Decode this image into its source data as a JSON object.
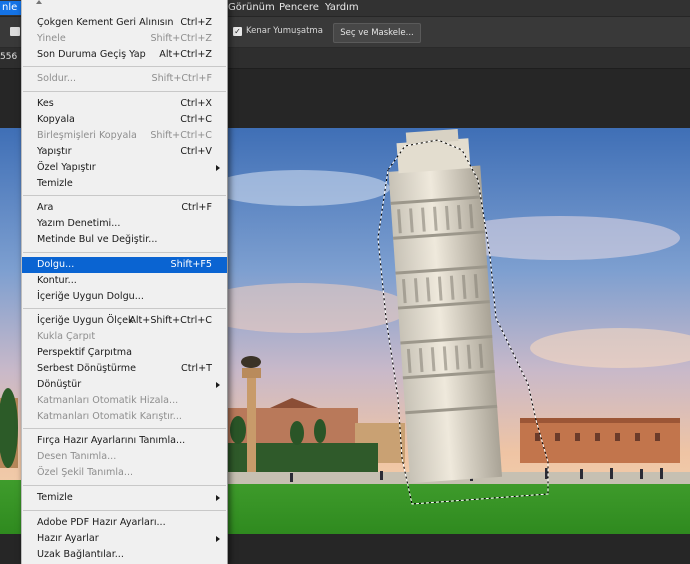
{
  "menubar": {
    "left_fragment": "nle",
    "items": [
      "Görünüm",
      "Pencere",
      "Yardım"
    ]
  },
  "options": {
    "antialias_label": "Kenar Yumuşatma",
    "antialias_checked": true,
    "select_mask_label": "Seç ve Maskele..."
  },
  "tab": {
    "fragment": "556"
  },
  "edit_menu": {
    "items": [
      {
        "label": "Çokgen Kement Geri Alınısın",
        "shortcut": "Ctrl+Z",
        "disabled": false
      },
      {
        "label": "Yinele",
        "shortcut": "Shift+Ctrl+Z",
        "disabled": true
      },
      {
        "label": "Son Duruma Geçiş Yap",
        "shortcut": "Alt+Ctrl+Z",
        "disabled": false
      },
      {
        "label": "Soldur...",
        "shortcut": "Shift+Ctrl+F",
        "disabled": true
      },
      {
        "label": "Kes",
        "shortcut": "Ctrl+X",
        "disabled": false
      },
      {
        "label": "Kopyala",
        "shortcut": "Ctrl+C",
        "disabled": false
      },
      {
        "label": "Birleşmişleri Kopyala",
        "shortcut": "Shift+Ctrl+C",
        "disabled": true
      },
      {
        "label": "Yapıştır",
        "shortcut": "Ctrl+V",
        "disabled": false
      },
      {
        "label": "Özel Yapıştır",
        "shortcut": "",
        "disabled": false,
        "submenu": true
      },
      {
        "label": "Temizle",
        "shortcut": "",
        "disabled": false
      },
      {
        "label": "Ara",
        "shortcut": "Ctrl+F",
        "disabled": false
      },
      {
        "label": "Yazım Denetimi...",
        "shortcut": "",
        "disabled": false
      },
      {
        "label": "Metinde Bul ve Değiştir...",
        "shortcut": "",
        "disabled": false
      },
      {
        "label": "Dolgu...",
        "shortcut": "Shift+F5",
        "disabled": false,
        "highlighted": true
      },
      {
        "label": "Kontur...",
        "shortcut": "",
        "disabled": false
      },
      {
        "label": "İçeriğe Uygun Dolgu...",
        "shortcut": "",
        "disabled": false
      },
      {
        "label": "İçeriğe Uygun Ölçek",
        "shortcut": "Alt+Shift+Ctrl+C",
        "disabled": false
      },
      {
        "label": "Kukla Çarpıt",
        "shortcut": "",
        "disabled": true
      },
      {
        "label": "Perspektif Çarpıtma",
        "shortcut": "",
        "disabled": false
      },
      {
        "label": "Serbest Dönüştürme",
        "shortcut": "Ctrl+T",
        "disabled": false
      },
      {
        "label": "Dönüştür",
        "shortcut": "",
        "disabled": false,
        "submenu": true
      },
      {
        "label": "Katmanları Otomatik Hizala...",
        "shortcut": "",
        "disabled": true
      },
      {
        "label": "Katmanları Otomatik Karıştır...",
        "shortcut": "",
        "disabled": true
      },
      {
        "label": "Fırça Hazır Ayarlarını Tanımla...",
        "shortcut": "",
        "disabled": false
      },
      {
        "label": "Desen Tanımla...",
        "shortcut": "",
        "disabled": true
      },
      {
        "label": "Özel Şekil Tanımla...",
        "shortcut": "",
        "disabled": true
      },
      {
        "label": "Temizle",
        "shortcut": "",
        "disabled": false,
        "submenu": true
      },
      {
        "label": "Adobe PDF Hazır Ayarları...",
        "shortcut": "",
        "disabled": false
      },
      {
        "label": "Hazır Ayarlar",
        "shortcut": "",
        "disabled": false,
        "submenu": true
      },
      {
        "label": "Uzak Bağlantılar...",
        "shortcut": "",
        "disabled": false
      }
    ]
  },
  "colors": {
    "accent": "#0a64d2",
    "menubar_highlight": "#1473e6"
  }
}
